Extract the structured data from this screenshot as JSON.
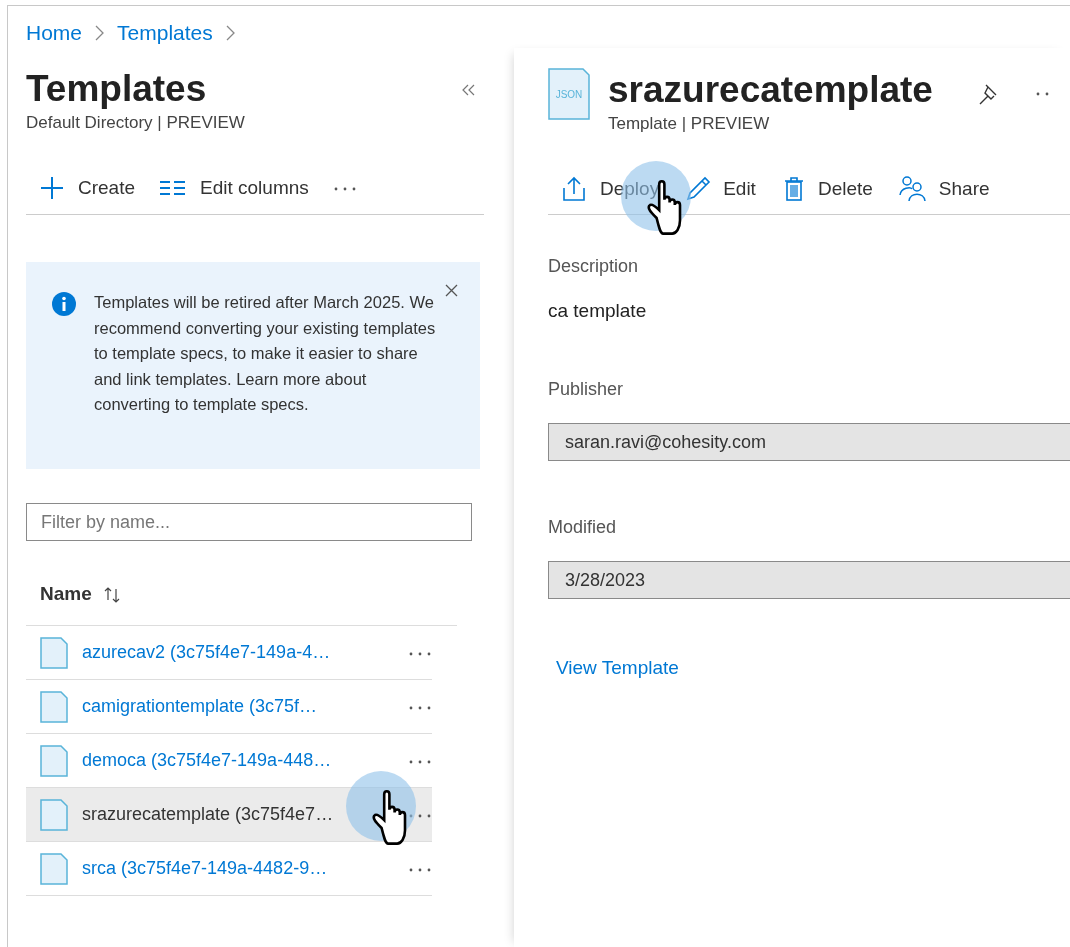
{
  "breadcrumb": [
    {
      "label": "Home"
    },
    {
      "label": "Templates"
    }
  ],
  "list_pane": {
    "title": "Templates",
    "subtitle": "Default Directory | PREVIEW",
    "toolbar": [
      {
        "kind": "create",
        "label": "Create"
      },
      {
        "kind": "columns",
        "label": "Edit columns"
      },
      {
        "kind": "more"
      }
    ],
    "notice": {
      "text": "Templates will be retired after March 2025. We recommend converting your existing templates to template specs, to make it easier to share and link templates. Learn more about converting to template specs."
    },
    "filter": {
      "placeholder": "Filter by name..."
    },
    "column": {
      "label": "Name"
    },
    "rows": [
      {
        "name": "azurecav2 (3c75f4e7-149a-4…",
        "selected": false
      },
      {
        "name": "camigrationtemplate (3c75f…",
        "selected": false
      },
      {
        "name": "democa (3c75f4e7-149a-448…",
        "selected": false
      },
      {
        "name": "srazurecatemplate (3c75f4e7…",
        "selected": true
      },
      {
        "name": "srca (3c75f4e7-149a-4482-9…",
        "selected": false
      }
    ]
  },
  "detail": {
    "title": "srazurecatemplate",
    "subtitle": "Template | PREVIEW",
    "icon_label": "JSON",
    "actions": [
      {
        "kind": "deploy",
        "label": "Deploy"
      },
      {
        "kind": "edit",
        "label": "Edit"
      },
      {
        "kind": "delete",
        "label": "Delete"
      },
      {
        "kind": "share",
        "label": "Share"
      }
    ],
    "fields": [
      {
        "kind": "text",
        "label": "Description",
        "value": "ca template"
      },
      {
        "kind": "readonly",
        "label": "Publisher",
        "value": "saran.ravi@cohesity.com"
      },
      {
        "kind": "readonly",
        "label": "Modified",
        "value": "3/28/2023"
      }
    ],
    "link": "View Template"
  }
}
